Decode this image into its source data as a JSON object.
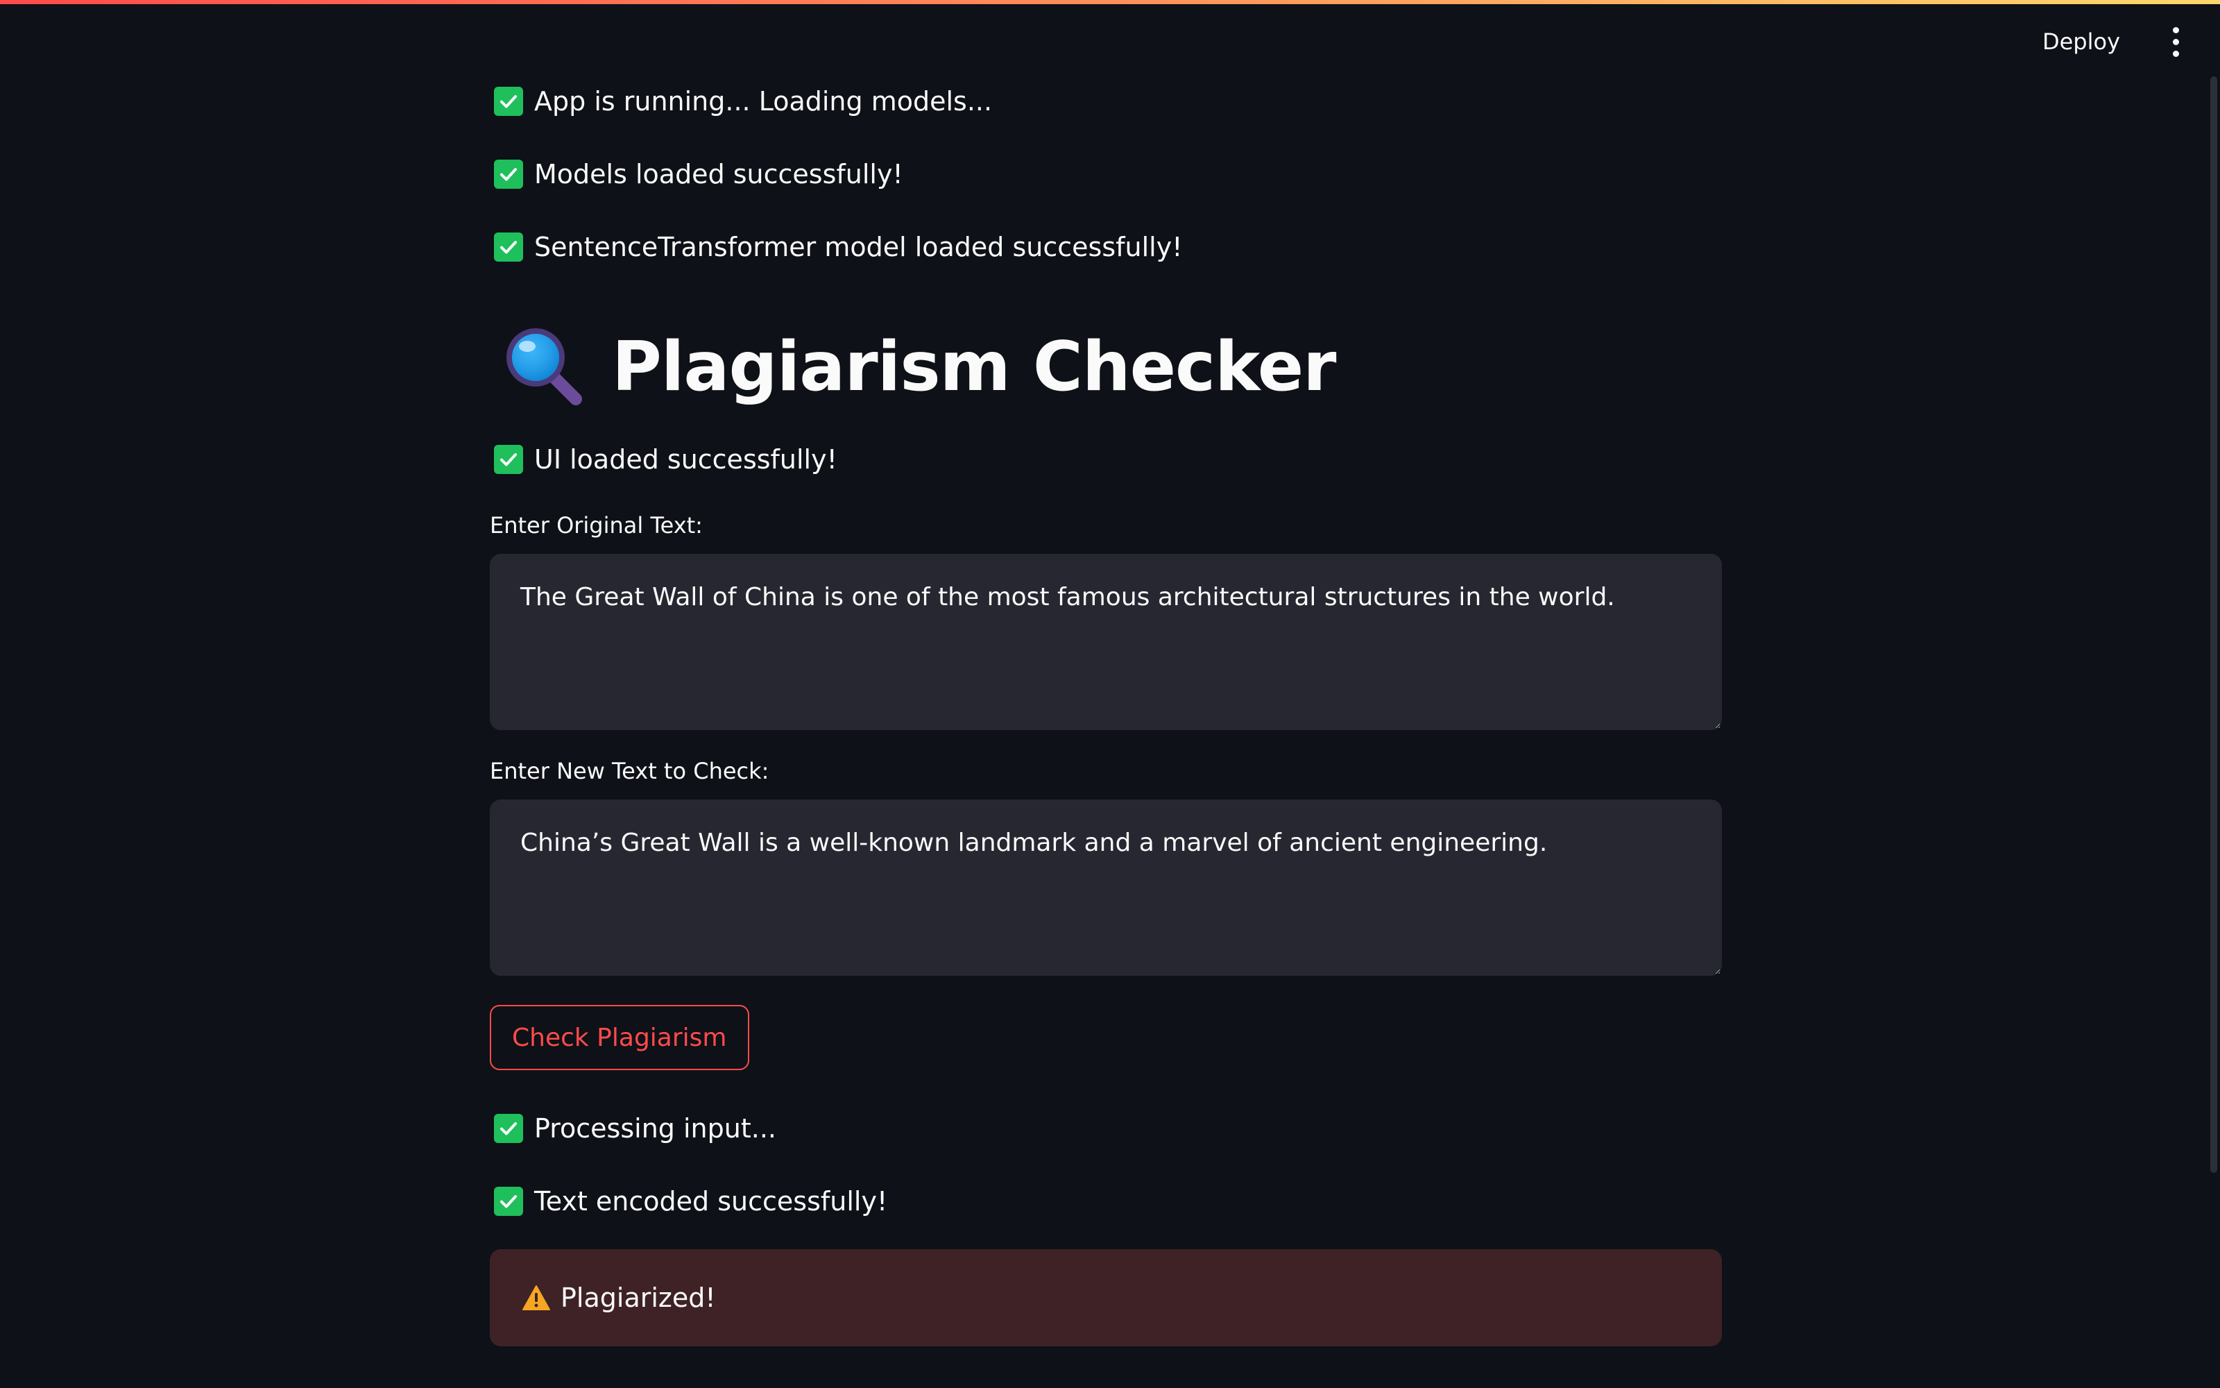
{
  "toolbar": {
    "deploy_label": "Deploy",
    "menu_icon": "more-vertical-icon"
  },
  "status_top": [
    {
      "text": "App is running... Loading models...",
      "icon": "check-icon"
    },
    {
      "text": "Models loaded successfully!",
      "icon": "check-icon"
    },
    {
      "text": "SentenceTransformer model loaded successfully!",
      "icon": "check-icon"
    }
  ],
  "header": {
    "icon": "magnifying-glass-icon",
    "title": "Plagiarism Checker"
  },
  "ui_status": {
    "text": "UI loaded successfully!",
    "icon": "check-icon"
  },
  "form": {
    "original": {
      "label": "Enter Original Text:",
      "value": "The Great Wall of China is one of the most famous architectural structures in the world."
    },
    "new_text": {
      "label": "Enter New Text to Check:",
      "value": "China’s Great Wall is a well-known landmark and a marvel of ancient engineering."
    },
    "check_button_label": "Check Plagiarism"
  },
  "status_bottom": [
    {
      "text": "Processing input...",
      "icon": "check-icon"
    },
    {
      "text": "Text encoded successfully!",
      "icon": "check-icon"
    }
  ],
  "result": {
    "icon": "warning-icon",
    "text": "Plagiarized!"
  },
  "colors": {
    "background": "#0e1117",
    "accent": "#ff4b4b",
    "success": "#1fbf5b",
    "alert_bg": "#3e2226",
    "input_bg": "#262730"
  }
}
